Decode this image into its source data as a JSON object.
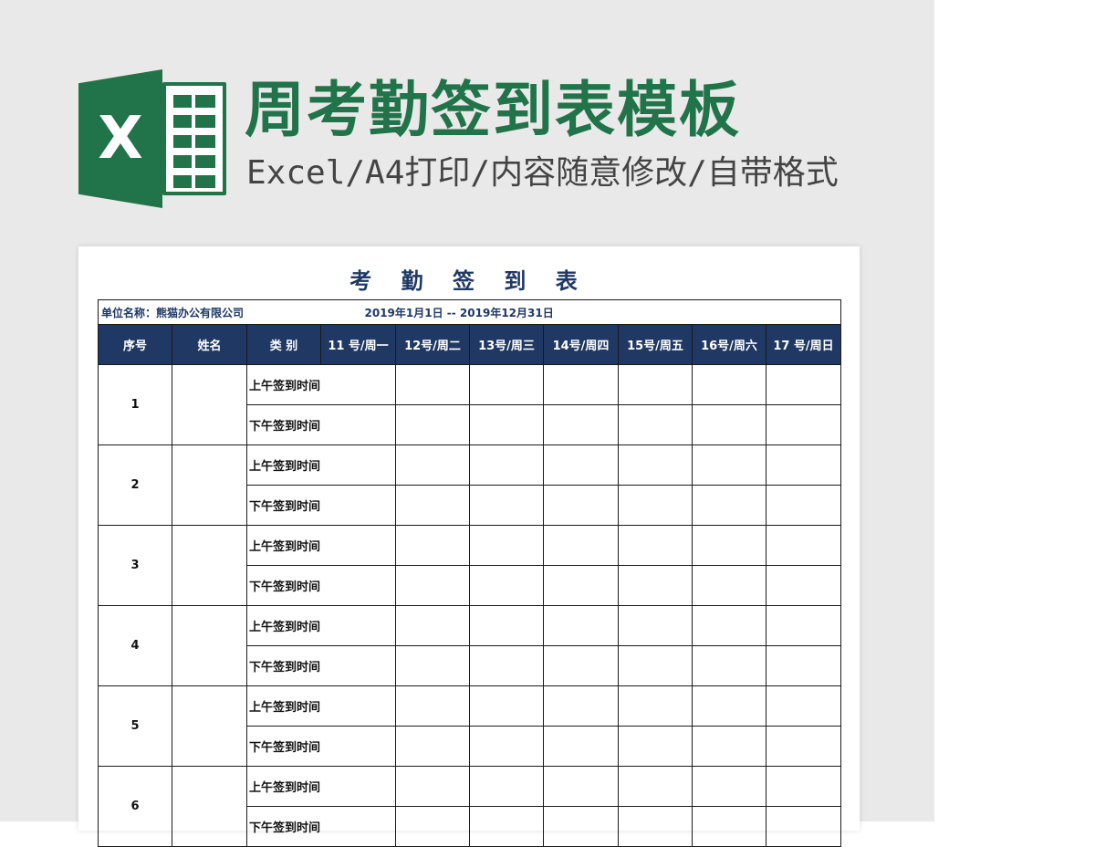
{
  "banner": {
    "logo_letter": "X",
    "title": "周考勤签到表模板",
    "subtitle": "Excel/A4打印/内容随意修改/自带格式"
  },
  "sheet": {
    "title": "考 勤 签 到 表",
    "unit_label": "单位名称：熊猫办公有限公司",
    "date_range": "2019年1月1日  --  2019年12月31日",
    "headers": [
      "序号",
      "姓名",
      "类 别",
      "11 号/周一",
      "12号/周二",
      "13号/周三",
      "14号/周四",
      "15号/周五",
      "16号/周六",
      "17 号/周日"
    ],
    "rows": [
      {
        "seq": "1",
        "am": "上午签到时间",
        "pm": "下午签到时间"
      },
      {
        "seq": "2",
        "am": "上午签到时间",
        "pm": "下午签到时间"
      },
      {
        "seq": "3",
        "am": "上午签到时间",
        "pm": "下午签到时间"
      },
      {
        "seq": "4",
        "am": "上午签到时间",
        "pm": "下午签到时间"
      },
      {
        "seq": "5",
        "am": "上午签到时间",
        "pm": "下午签到时间"
      },
      {
        "seq": "6",
        "am": "上午签到时间",
        "pm": "下午签到时间"
      }
    ]
  },
  "colors": {
    "excel_green": "#21744a",
    "header_navy": "#1f3864",
    "background_gray": "#e9e9e9"
  }
}
